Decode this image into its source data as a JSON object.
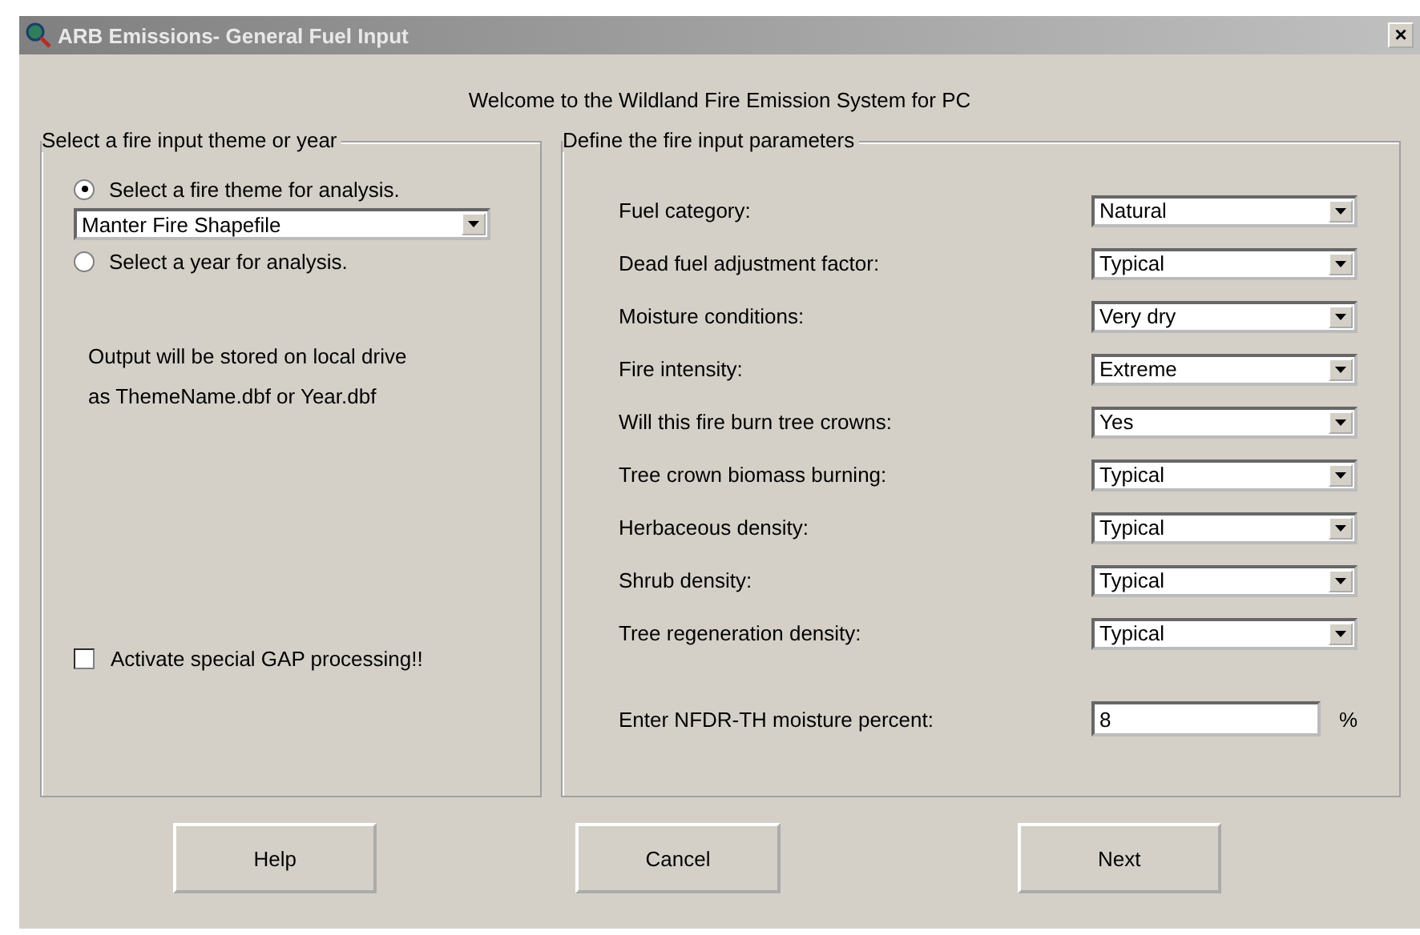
{
  "window": {
    "title": "ARB Emissions- General Fuel Input",
    "close": "×"
  },
  "welcome": "Welcome to the Wildland Fire Emission System for PC",
  "left_group": {
    "title": "Select a fire input theme or year",
    "options": [
      {
        "label": "Select a fire theme for analysis.",
        "selected": true
      },
      {
        "label": "Select a year for analysis.",
        "selected": false
      }
    ],
    "theme_dropdown": {
      "value": "Manter Fire Shapefile"
    },
    "note": [
      "Output will be stored on local drive",
      "as ThemeName.dbf or Year.dbf"
    ],
    "gap_checkbox": {
      "label": "Activate special GAP processing!!",
      "checked": false
    }
  },
  "right_group": {
    "title": "Define the fire input parameters",
    "params": [
      {
        "label": "Fuel category:",
        "value": "Natural"
      },
      {
        "label": "Dead fuel adjustment factor:",
        "value": "Typical"
      },
      {
        "label": "Moisture conditions:",
        "value": "Very dry"
      },
      {
        "label": "Fire intensity:",
        "value": "Extreme"
      },
      {
        "label": "Will this fire burn tree crowns:",
        "value": "Yes"
      },
      {
        "label": "Tree crown biomass burning:",
        "value": "Typical"
      },
      {
        "label": "Herbaceous density:",
        "value": "Typical"
      },
      {
        "label": "Shrub density:",
        "value": "Typical"
      },
      {
        "label": "Tree regeneration density:",
        "value": "Typical"
      }
    ],
    "moisture": {
      "label": "Enter NFDR-TH moisture percent:",
      "value": "8",
      "unit": "%"
    }
  },
  "buttons": [
    "Help",
    "Cancel",
    "Next"
  ]
}
